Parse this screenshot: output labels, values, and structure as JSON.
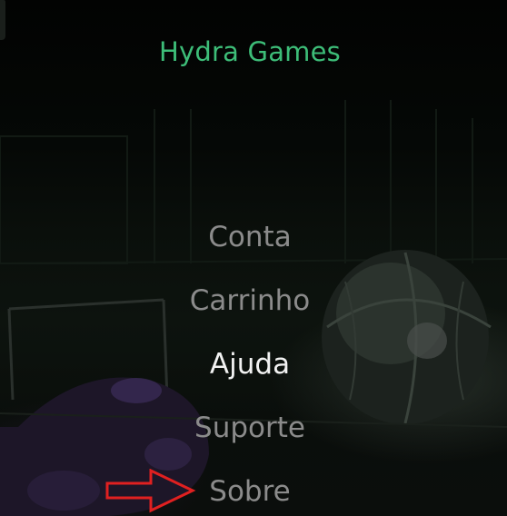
{
  "app": {
    "title": "Hydra Games"
  },
  "menu": {
    "items": [
      {
        "label": "Conta",
        "active": false
      },
      {
        "label": "Carrinho",
        "active": false
      },
      {
        "label": "Ajuda",
        "active": true
      },
      {
        "label": "Suporte",
        "active": false
      },
      {
        "label": "Sobre",
        "active": false
      }
    ]
  },
  "annotation": {
    "arrow_color": "#e02020",
    "points_to": "Sobre"
  },
  "colors": {
    "title": "#3dbd78",
    "menu_inactive": "#8b8b8b",
    "menu_active": "#f2f2f2",
    "background": "#0a0e0b"
  }
}
